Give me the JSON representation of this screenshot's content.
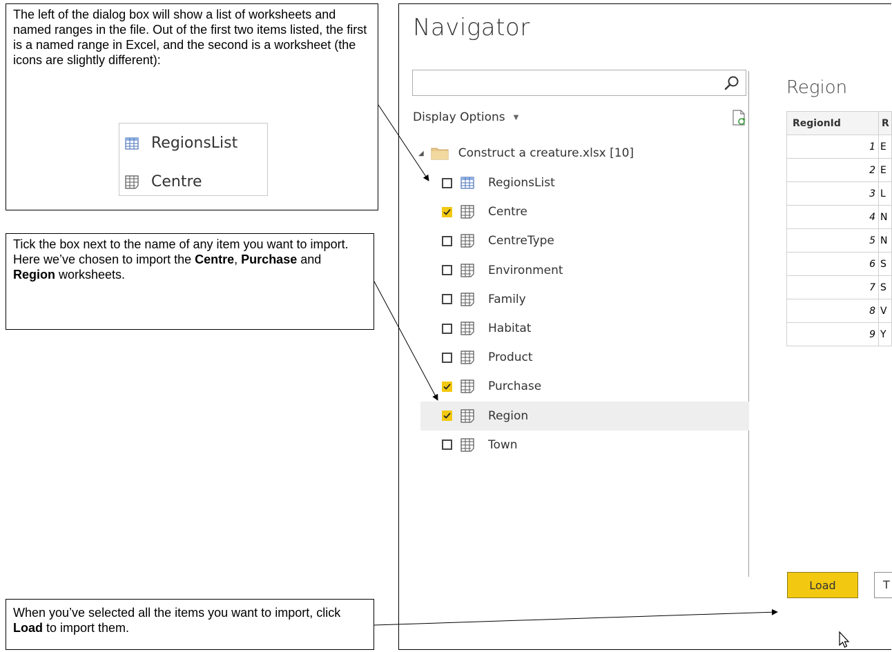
{
  "callouts": {
    "intro": "The left of the dialog box will show a list of worksheets and named ranges in the file.  Out of the first two items listed, the first is a named range in Excel, and the second is a worksheet (the icons are slightly different):",
    "tick": {
      "line1": "Tick the box next to the name of any item you want to import.  Here we’ve chosen to import the ",
      "b1": "Centre",
      "sep1": ", ",
      "b2": "Purchase",
      "sep2": " and ",
      "b3": "Region",
      "end": " worksheets."
    },
    "load": {
      "pre": "When you’ve selected all the items you want to import, click ",
      "b": "Load",
      "post": " to import them."
    }
  },
  "inset": {
    "items": [
      {
        "label": "RegionsList",
        "icon": "named-range-icon"
      },
      {
        "label": "Centre",
        "icon": "worksheet-icon"
      }
    ]
  },
  "navigator": {
    "title": "Navigator",
    "search_placeholder": "",
    "display_options": "Display Options",
    "root": "Construct a creature.xlsx [10]",
    "items": [
      {
        "label": "RegionsList",
        "checked": false,
        "icon": "named-range-icon"
      },
      {
        "label": "Centre",
        "checked": true,
        "icon": "worksheet-icon"
      },
      {
        "label": "CentreType",
        "checked": false,
        "icon": "worksheet-icon"
      },
      {
        "label": "Environment",
        "checked": false,
        "icon": "worksheet-icon"
      },
      {
        "label": "Family",
        "checked": false,
        "icon": "worksheet-icon"
      },
      {
        "label": "Habitat",
        "checked": false,
        "icon": "worksheet-icon"
      },
      {
        "label": "Product",
        "checked": false,
        "icon": "worksheet-icon"
      },
      {
        "label": "Purchase",
        "checked": true,
        "icon": "worksheet-icon"
      },
      {
        "label": "Region",
        "checked": true,
        "icon": "worksheet-icon",
        "selected": true
      },
      {
        "label": "Town",
        "checked": false,
        "icon": "worksheet-icon"
      }
    ],
    "preview": {
      "title": "Region",
      "columns": [
        "RegionId",
        "R"
      ],
      "rows": [
        [
          "1",
          "E"
        ],
        [
          "2",
          "E"
        ],
        [
          "3",
          "L"
        ],
        [
          "4",
          "N"
        ],
        [
          "5",
          "N"
        ],
        [
          "6",
          "S"
        ],
        [
          "7",
          "S"
        ],
        [
          "8",
          "V"
        ],
        [
          "9",
          "Y"
        ]
      ]
    },
    "load_label": "Load",
    "transform_label": "T"
  },
  "colors": {
    "accent": "#f2c811",
    "selected_row": "#eeeeee"
  }
}
